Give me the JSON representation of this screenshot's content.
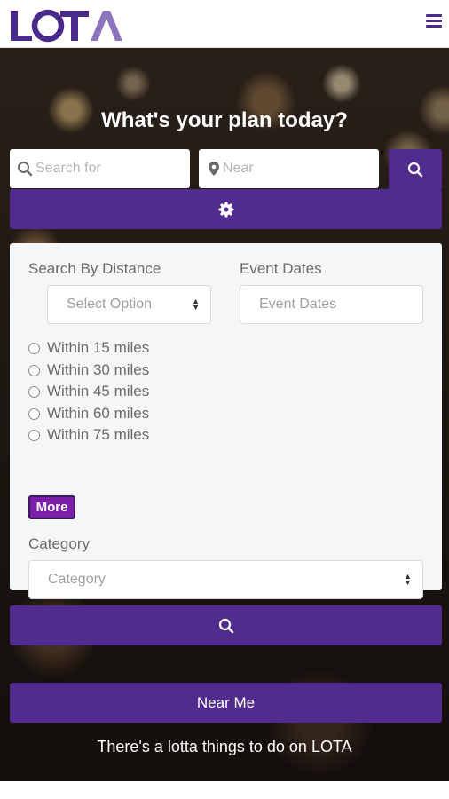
{
  "header": {
    "logo_text": "LOTA",
    "menu_icon": "hamburger-menu-icon",
    "brand_color": "#4a2b8c"
  },
  "hero": {
    "title": "What's your plan today?",
    "search_placeholder": "Search for",
    "near_placeholder": "Near",
    "search_icon": "search-icon",
    "location_icon": "map-marker-icon",
    "settings_icon": "gear-icon",
    "button_color": "#522b8f"
  },
  "filters": {
    "distance_label": "Search By Distance",
    "distance_select_value": "Select Option",
    "event_dates_label": "Event Dates",
    "event_dates_placeholder": "Event Dates",
    "radio_options": [
      "Within 15 miles",
      "Within 30 miles",
      "Within 45 miles",
      "Within 60 miles",
      "Within 75 miles"
    ],
    "more_label": "More",
    "more_color": "#7b1fa8",
    "category_label": "Category",
    "category_select_value": "Category"
  },
  "actions": {
    "near_me_label": "Near Me"
  },
  "tagline": "There's a lotta things to do on LOTA"
}
